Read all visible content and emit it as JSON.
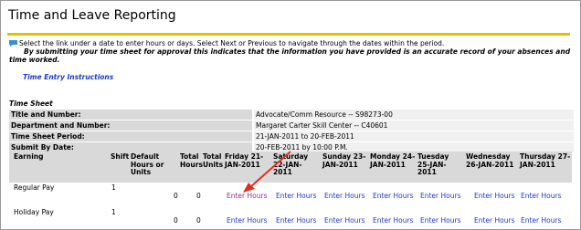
{
  "page": {
    "title": "Time and Leave Reporting",
    "info_line": "Select the link under a date to enter hours or days. Select Next or Previous to navigate through the dates within the period.",
    "info_emphasis": "By submitting your time sheet for approval this indicates that the information you have provided is an accurate record of your absences and time worked.",
    "instructions_link": "Time Entry Instructions"
  },
  "time_sheet": {
    "label": "Time Sheet",
    "fields": [
      {
        "key": "Title and Number:",
        "value": "Advocate/Comm Resource -- S98273-00"
      },
      {
        "key": "Department and Number:",
        "value": "Margaret Carter Skill Center -- C40601"
      },
      {
        "key": "Time Sheet Period:",
        "value": "21-JAN-2011 to 20-FEB-2011"
      },
      {
        "key": "Submit By Date:",
        "value": "20-FEB-2011 by 10:00 P.M."
      }
    ]
  },
  "grid": {
    "headers": {
      "earning": "Earning",
      "shift": "Shift",
      "default_units": "Default Hours or Units",
      "total_hours": "Total Hours",
      "total_units": "Total Units",
      "days": [
        "Friday 21-JAN-2011",
        "Saturday 22-JAN-2011",
        "Sunday 23-JAN-2011",
        "Monday 24-JAN-2011",
        "Tuesday 25-JAN-2011",
        "Wednesday 26-JAN-2011",
        "Thursday 27-JAN-2011"
      ]
    },
    "rows": [
      {
        "earning": "Regular Pay",
        "shift": "1",
        "total_hours": "0",
        "total_units": "0",
        "link": "Enter Hours"
      },
      {
        "earning": "Holiday Pay",
        "shift": "1",
        "total_hours": "0",
        "total_units": "0",
        "link": "Enter Hours"
      }
    ]
  },
  "colors": {
    "accent_rule": "#e2c200",
    "link": "#1a3cc8",
    "visited_link": "#9a2a9a",
    "arrow": "#e0301e"
  }
}
